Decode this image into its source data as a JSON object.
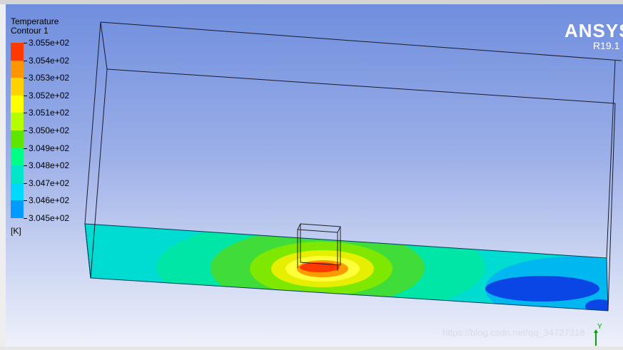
{
  "legend": {
    "title": "Temperature",
    "subtitle": "Contour 1",
    "unit": "[K]",
    "levels": [
      "3.055e+02",
      "3.054e+02",
      "3.053e+02",
      "3.052e+02",
      "3.051e+02",
      "3.050e+02",
      "3.049e+02",
      "3.048e+02",
      "3.047e+02",
      "3.046e+02",
      "3.045e+02"
    ],
    "colors": [
      "#ff3a00",
      "#ff9500",
      "#ffd200",
      "#ffff00",
      "#b6ff00",
      "#5ce600",
      "#00ff85",
      "#00e6c8",
      "#00d9ff",
      "#009bff",
      "#0037ff"
    ]
  },
  "branding": {
    "logo": "ANSYS",
    "version": "R19.1"
  },
  "watermark": "https://blog.csdn.net/qq_34727318",
  "axis_label": "Y"
}
